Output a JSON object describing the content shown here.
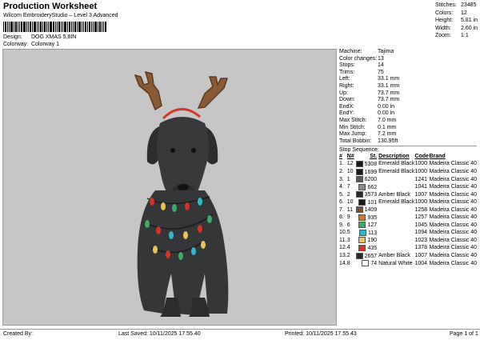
{
  "header": {
    "title": "Production Worksheet",
    "subtitle": "Wilcom EmbroideryStudio – Level 3 Advanced",
    "design_label": "Design:",
    "design_value": "DOG XMAS 5,8IN",
    "colorway_label": "Colorway:",
    "colorway_value": "Colorway 1"
  },
  "stats": [
    {
      "label": "Stitches:",
      "value": "23485"
    },
    {
      "label": "Colors:",
      "value": "12"
    },
    {
      "label": "Height:",
      "value": "5.81 in"
    },
    {
      "label": "Width:",
      "value": "2.60 in"
    },
    {
      "label": "Zoom:",
      "value": "1:1"
    }
  ],
  "machine": [
    {
      "label": "Machine:",
      "value": "Tajima"
    },
    {
      "label": "Color changes:",
      "value": "13"
    },
    {
      "label": "Stops:",
      "value": "14"
    },
    {
      "label": "Trims:",
      "value": "75"
    },
    {
      "label": "Left:",
      "value": "33.1 mm"
    },
    {
      "label": "Right:",
      "value": "33.1 mm"
    },
    {
      "label": "Up:",
      "value": "73.7 mm"
    },
    {
      "label": "Down:",
      "value": "73.7 mm"
    },
    {
      "label": "EndX:",
      "value": "0.00 in"
    },
    {
      "label": "EndY:",
      "value": "0.00 in"
    },
    {
      "label": "Max Stitch:",
      "value": "7.0 mm"
    },
    {
      "label": "Min Stitch:",
      "value": "0.1 mm"
    },
    {
      "label": "Max Jump:",
      "value": "7.2 mm"
    },
    {
      "label": "Total Bobbin:",
      "value": "130.95ft"
    }
  ],
  "stop_sequence": {
    "title": "Stop Sequence:",
    "headers": [
      "#",
      "N#",
      "St.",
      "Description",
      "Code",
      "Brand"
    ],
    "rows": [
      {
        "num": "1.",
        "n": "12",
        "color": "#1a1a1a",
        "st": "5308",
        "desc": "Emerald Black",
        "code": "1000",
        "brand": "Madeira Classic 40"
      },
      {
        "num": "2.",
        "n": "10",
        "color": "#1a1a1a",
        "st": "1699",
        "desc": "Emerald Black",
        "code": "1000",
        "brand": "Madeira Classic 40"
      },
      {
        "num": "3.",
        "n": "1",
        "color": "#5a5a5a",
        "st": "6200",
        "desc": "",
        "code": "1241",
        "brand": "Madeira Classic 40"
      },
      {
        "num": "4.",
        "n": "7",
        "color": "#8a8a8a",
        "st": "662",
        "desc": "",
        "code": "1041",
        "brand": "Madeira Classic 40"
      },
      {
        "num": "5.",
        "n": "2",
        "color": "#2a2a2a",
        "st": "3573",
        "desc": "Amber Black",
        "code": "1007",
        "brand": "Madeira Classic 40"
      },
      {
        "num": "6.",
        "n": "10",
        "color": "#1a1a1a",
        "st": "101",
        "desc": "Emerald Black",
        "code": "1000",
        "brand": "Madeira Classic 40"
      },
      {
        "num": "7.",
        "n": "11",
        "color": "#7a5234",
        "st": "1409",
        "desc": "",
        "code": "1258",
        "brand": "Madeira Classic 40"
      },
      {
        "num": "8.",
        "n": "9",
        "color": "#c77a2e",
        "st": "935",
        "desc": "",
        "code": "1257",
        "brand": "Madeira Classic 40"
      },
      {
        "num": "9.",
        "n": "6",
        "color": "#3fa86a",
        "st": "127",
        "desc": "",
        "code": "1045",
        "brand": "Madeira Classic 40"
      },
      {
        "num": "10.",
        "n": "5",
        "color": "#2db8c9",
        "st": "113",
        "desc": "",
        "code": "1094",
        "brand": "Madeira Classic 40"
      },
      {
        "num": "11.",
        "n": "3",
        "color": "#e8c35a",
        "st": "190",
        "desc": "",
        "code": "1023",
        "brand": "Madeira Classic 40"
      },
      {
        "num": "12.",
        "n": "4",
        "color": "#d8302a",
        "st": "435",
        "desc": "",
        "code": "1378",
        "brand": "Madeira Classic 40"
      },
      {
        "num": "13.",
        "n": "2",
        "color": "#2a2a2a",
        "st": "2657",
        "desc": "Amber Black",
        "code": "1007",
        "brand": "Madeira Classic 40"
      },
      {
        "num": "14.",
        "n": "8",
        "color": "#ffffff",
        "st": "74",
        "desc": "Natural White",
        "code": "1004",
        "brand": "Madeira Classic 40"
      }
    ]
  },
  "footer": {
    "created": "Created By:",
    "saved": "Last Saved: 10/11/2025 17.55.40",
    "printed": "Printed: 10/11/2025 17.55.43",
    "page": "Page 1 of 1"
  }
}
